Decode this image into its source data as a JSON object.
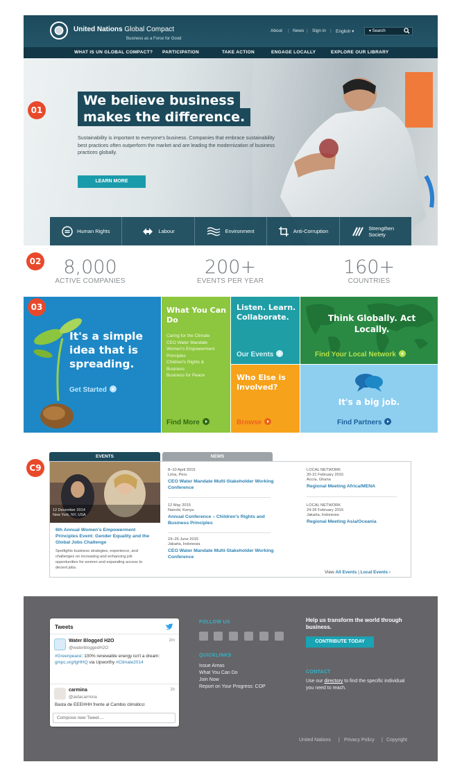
{
  "markers": {
    "m1": "01",
    "m2": "02",
    "m3": "03",
    "m4": "C9"
  },
  "header": {
    "brand_main": "United Nations",
    "brand_sub": "Global Compact",
    "tagline": "Business as a Force for Good",
    "utility": {
      "about": "About",
      "news": "News",
      "sign_in": "Sign in",
      "language": "English ▾"
    },
    "search_placeholder": "▾ Search",
    "nav": [
      "WHAT IS UN GLOBAL COMPACT?",
      "PARTICIPATION",
      "TAKE ACTION",
      "ENGAGE LOCALLY",
      "EXPLORE OUR LIBRARY"
    ]
  },
  "hero": {
    "headline_1": "We believe business",
    "headline_2": "makes the difference.",
    "body": "Sustainability is important to everyone's business. Companies that embrace sustainability best practices often outperform the market and are leading the modernization of business practices globally.",
    "cta": "LEARN MORE",
    "issues": [
      {
        "label": "Human Rights",
        "icon": "human-rights-icon"
      },
      {
        "label": "Labour",
        "icon": "labour-icon"
      },
      {
        "label": "Environment",
        "icon": "environment-icon"
      },
      {
        "label": "Anti-Corruption",
        "icon": "anti-corruption-icon"
      },
      {
        "label": "Strengthen Society",
        "icon": "strengthen-society-icon"
      }
    ]
  },
  "stats": [
    {
      "value": "8,000",
      "label": "ACTIVE COMPANIES"
    },
    {
      "value": "200+",
      "label": "EVENTS PER YEAR"
    },
    {
      "value": "160+",
      "label": "COUNTRIES"
    }
  ],
  "tiles": {
    "idea": {
      "title": "It's a simple idea that is spreading.",
      "link": "Get Started",
      "color": "#1e88c6"
    },
    "what": {
      "title": "What You Can Do",
      "items": [
        "Caring for the Climate",
        "CEO Water Mandate",
        "Women's Empowerment Principles",
        "Children's Rights & Business",
        "Business for Peace"
      ],
      "link": "Find More",
      "color": "#8dc63f"
    },
    "listen": {
      "title": "Listen. Learn. Collaborate.",
      "link": "Our Events",
      "color": "#1f9ea6"
    },
    "who": {
      "title": "Who Else is Involved?",
      "link": "Browse",
      "color": "#f7a21b"
    },
    "think": {
      "title": "Think Globally. Act Locally.",
      "link": "Find Your Local Network",
      "color": "#2a8a43"
    },
    "big": {
      "title": "It's a big job.",
      "link": "Find Partners",
      "color": "#8ecff0"
    }
  },
  "events": {
    "tab_events": "EVENTS",
    "tab_news": "NEWS",
    "featured": {
      "caption_date": "12 December 2014",
      "caption_place": "New York, NY, USA",
      "title": "6th Annual Women's Empowerment Principles Event: Gender Equality and the Global Jobs Challenge",
      "desc": "Spotlights business strategies, experience, and challenges on increasing and enhancing job opportunities for women and expanding access to decent jobs."
    },
    "col1": [
      {
        "date": "8–10 April 2015",
        "place": "Lima, Peru",
        "title": "CEO Water Mandate Multi-Stakeholder Working Conference"
      },
      {
        "date": "12 May 2015",
        "place": "Nairobi, Kenya",
        "title": "Annual Conference – Children's Rights and Business Principles"
      },
      {
        "date": "24–26 June 2015",
        "place": "Jakarta, Indonesia",
        "title": "CEO Water Mandate Multi-Stakeholder Working Conference"
      }
    ],
    "col2": [
      {
        "kind": "LOCAL NETWORK",
        "date": "20-21 February 2015",
        "place": "Accra, Ghana",
        "title": "Regional Meeting Africa/MENA"
      },
      {
        "kind": "LOCAL NETWORK",
        "date": "24-26 February 2015",
        "place": "Jakarta, Indonesia",
        "title": "Regional Meeting Asia/Oceania"
      }
    ],
    "view_prefix": "View",
    "view_all": "All Events",
    "view_sep": "|",
    "view_local": "Local Events",
    "view_arrow": "›"
  },
  "tweets": {
    "header": "Tweets",
    "items": [
      {
        "name": "Water Blogged H2O",
        "handle": "@waterbloggedH2O",
        "time": "2m",
        "pre": "#Greenpeace",
        "text": ": 100% renewable energy isn't a dream: ",
        "link": "gmpc.org/lgHHQ",
        "post": " via Upworthy ",
        "tag": "#Climate2014"
      },
      {
        "name": "carmina",
        "handle": "@aidacarmina",
        "time": "1h",
        "text": "Basta de EEEHHH frente al Cambio climático:"
      }
    ],
    "compose": "Compose new Tweet...."
  },
  "footer": {
    "follow_head": "FOLLOW US",
    "social_icons": [
      "twitter-icon",
      "youtube-icon",
      "linkedin-icon",
      "facebook-icon",
      "flickr-icon",
      "rss-icon"
    ],
    "quick_head": "QUICKLINKS",
    "quick": [
      "Issue Areas",
      "What You Can Do",
      "Join Now",
      "Report on Your Progress: COP"
    ],
    "help_head": "Help us transform the world through business.",
    "contribute": "CONTRIBUTE TODAY",
    "contact_head": "CONTACT",
    "contact_pre": "Use our ",
    "contact_link": "directory",
    "contact_post": " to find the specific individual you need to reach.",
    "legal": [
      "United Nations",
      "Privacy Policy",
      "Copyright"
    ]
  }
}
